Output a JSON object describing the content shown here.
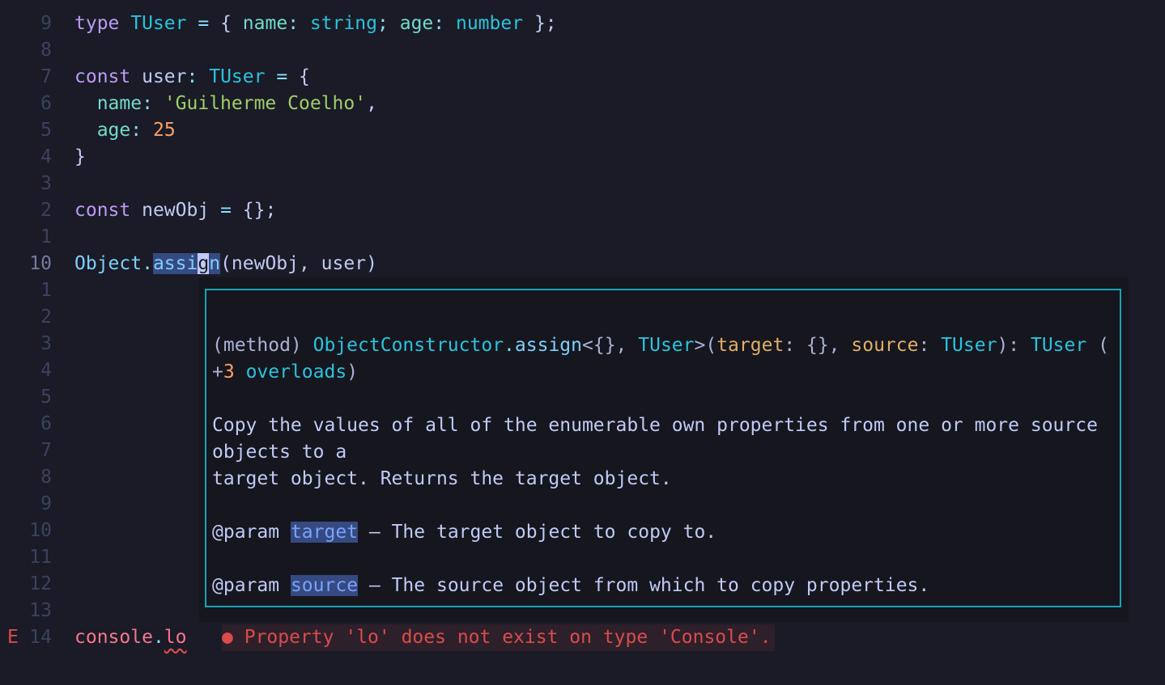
{
  "editor": {
    "lines": [
      {
        "num": "9"
      },
      {
        "num": "8"
      },
      {
        "num": "7"
      },
      {
        "num": "6"
      },
      {
        "num": "5"
      },
      {
        "num": "4"
      },
      {
        "num": "3"
      },
      {
        "num": "2"
      },
      {
        "num": "1"
      },
      {
        "num": "10"
      },
      {
        "num": "1"
      },
      {
        "num": "2"
      },
      {
        "num": "3"
      },
      {
        "num": "4"
      },
      {
        "num": "5"
      },
      {
        "num": "6"
      },
      {
        "num": "7"
      },
      {
        "num": "8"
      },
      {
        "num": "9"
      },
      {
        "num": "10"
      },
      {
        "num": "11"
      },
      {
        "num": "12"
      },
      {
        "num": "13"
      },
      {
        "num": "14"
      }
    ],
    "code": {
      "l9": [
        "type",
        "TUser",
        "=",
        "{",
        "name",
        ":",
        "string",
        ";",
        "age",
        ":",
        "number",
        "};"
      ],
      "l7": [
        "const",
        "user",
        ":",
        "TUser",
        "=",
        "{"
      ],
      "l6": [
        "name",
        ":",
        "'Guilherme Coelho'",
        ","
      ],
      "l5": [
        "age",
        ":",
        "25"
      ],
      "l4": [
        "}"
      ],
      "l2": [
        "const",
        "newObj",
        "=",
        "{};"
      ],
      "l10": [
        "Object",
        ".",
        "assi",
        "g",
        "n",
        "(newObj, user)"
      ],
      "l14": [
        "console",
        ".",
        "lo"
      ]
    },
    "sign_column": "E"
  },
  "hover": {
    "sig1": [
      "(method)",
      "ObjectConstructor",
      ".",
      "assign",
      "<{}, ",
      "TUser",
      ">(",
      "target",
      ": {}, ",
      "source",
      ": ",
      "TUser",
      "): ",
      "TUser",
      " ("
    ],
    "sig2": [
      "+",
      "3",
      " overloads",
      ")"
    ],
    "desc1": "Copy the values of all of the enumerable own properties from one or more source",
    "desc2": "objects to a",
    "desc3": "target object. Returns the target object.",
    "param1": {
      "tag": "@param",
      "name": "target",
      "text": " — The target object to copy to."
    },
    "param2": {
      "tag": "@param",
      "name": "source",
      "text": " — The source object from which to copy properties."
    }
  },
  "diagnostic": {
    "bullet": "●",
    "message": "Property 'lo' does not exist on type 'Console'."
  },
  "colors": {
    "background": "#1a1b26",
    "keyword": "#bb9af7",
    "type": "#2ac3de",
    "string": "#9ece6a",
    "number": "#ff9e64",
    "error": "#db4b4b",
    "hover_border": "#16a3b8"
  }
}
